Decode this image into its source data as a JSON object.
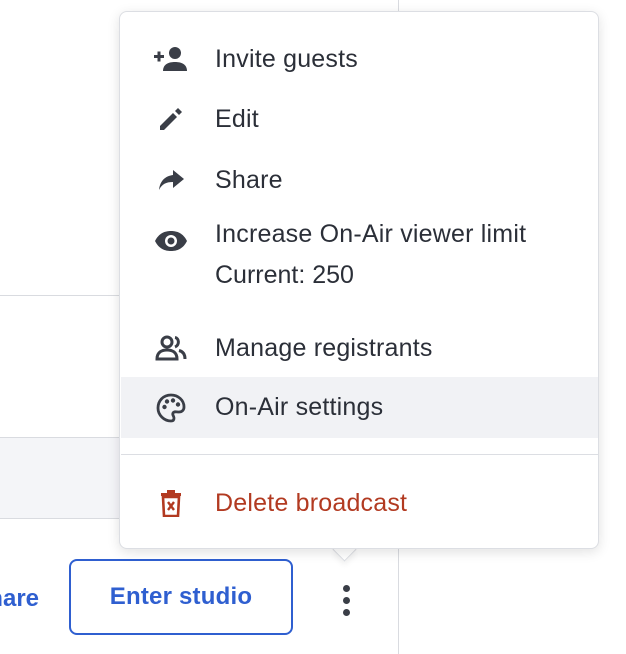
{
  "background": {
    "share_partial": "Share",
    "enter_studio_label": "Enter studio"
  },
  "menu": {
    "items": [
      {
        "label": "Invite guests",
        "icon": "add-person-icon"
      },
      {
        "label": "Edit",
        "icon": "pencil-icon"
      },
      {
        "label": "Share",
        "icon": "share-arrow-icon"
      },
      {
        "label": "Increase On-Air viewer limit",
        "sublabel": "Current: 250",
        "icon": "eye-icon"
      },
      {
        "label": "Manage registrants",
        "icon": "people-icon"
      },
      {
        "label": "On-Air settings",
        "icon": "palette-icon",
        "highlighted": true
      },
      {
        "label": "Delete broadcast",
        "icon": "trash-icon",
        "danger": true
      }
    ]
  },
  "colors": {
    "accent": "#2f5fd0",
    "danger": "#b23a21",
    "hover": "#f1f2f5"
  }
}
